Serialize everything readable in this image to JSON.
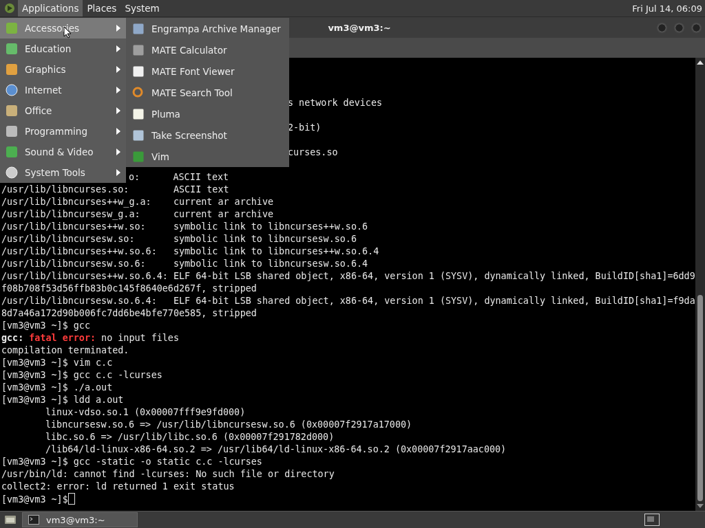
{
  "top_panel": {
    "menus": [
      {
        "label": "Applications",
        "selected": true
      },
      {
        "label": "Places",
        "selected": false
      },
      {
        "label": "System",
        "selected": false
      }
    ],
    "clock": "Fri Jul 14, 06:09"
  },
  "applications_menu": {
    "items": [
      {
        "label": "Accessories",
        "selected": true
      },
      {
        "label": "Education",
        "selected": false
      },
      {
        "label": "Graphics",
        "selected": false
      },
      {
        "label": "Internet",
        "selected": false
      },
      {
        "label": "Office",
        "selected": false
      },
      {
        "label": "Programming",
        "selected": false
      },
      {
        "label": "Sound & Video",
        "selected": false
      },
      {
        "label": "System Tools",
        "selected": false
      }
    ],
    "submenu": [
      {
        "label": "Engrampa Archive Manager"
      },
      {
        "label": "MATE Calculator"
      },
      {
        "label": "MATE Font Viewer"
      },
      {
        "label": "MATE Search Tool"
      },
      {
        "label": "Pluma"
      },
      {
        "label": "Take Screenshot"
      },
      {
        "label": "Vim"
      }
    ]
  },
  "window": {
    "title": "vm3@vm3:~"
  },
  "terminal": {
    "lines": [
      {
        "kind": "blank"
      },
      {
        "kind": "blank"
      },
      {
        "kind": "blank"
      },
      {
        "kind": "behind-submenu",
        "text": "s network devices"
      },
      {
        "kind": "blank"
      },
      {
        "kind": "behind-submenu",
        "text": "2-bit)"
      },
      {
        "kind": "blank"
      },
      {
        "kind": "behind-submenu",
        "text": "curses.so"
      },
      {
        "kind": "blank"
      },
      {
        "kind": "behind-menu",
        "text": "o:      ASCII text"
      },
      {
        "kind": "plain",
        "text": "/usr/lib/libncurses.so:        ASCII text"
      },
      {
        "kind": "plain",
        "text": "/usr/lib/libncurses++w_g.a:    current ar archive"
      },
      {
        "kind": "plain",
        "text": "/usr/lib/libncursesw_g.a:      current ar archive"
      },
      {
        "kind": "plain",
        "text": "/usr/lib/libncurses++w.so:     symbolic link to libncurses++w.so.6"
      },
      {
        "kind": "plain",
        "text": "/usr/lib/libncursesw.so:       symbolic link to libncursesw.so.6"
      },
      {
        "kind": "plain",
        "text": "/usr/lib/libncurses++w.so.6:   symbolic link to libncurses++w.so.6.4"
      },
      {
        "kind": "plain",
        "text": "/usr/lib/libncursesw.so.6:     symbolic link to libncursesw.so.6.4"
      },
      {
        "kind": "plain",
        "text": "/usr/lib/libncurses++w.so.6.4: ELF 64-bit LSB shared object, x86-64, version 1 (SYSV), dynamically linked, BuildID[sha1]=6dd9"
      },
      {
        "kind": "plain",
        "text": "f08b708f53d56ffb83b0c145f8640e6d267f, stripped"
      },
      {
        "kind": "plain",
        "text": "/usr/lib/libncursesw.so.6.4:   ELF 64-bit LSB shared object, x86-64, version 1 (SYSV), dynamically linked, BuildID[sha1]=f9da"
      },
      {
        "kind": "plain",
        "text": "8d7a46a172d90b006fc7dd6be4bfe770e585, stripped"
      },
      {
        "kind": "plain",
        "text": "[vm3@vm3 ~]$ gcc"
      },
      {
        "kind": "error",
        "parts": [
          {
            "text": "gcc:",
            "kind": "program"
          },
          {
            "text": " fatal error:",
            "kind": "severity"
          },
          {
            "text": " no input files",
            "kind": "message"
          }
        ]
      },
      {
        "kind": "plain",
        "text": "compilation terminated."
      },
      {
        "kind": "plain",
        "text": "[vm3@vm3 ~]$ vim c.c"
      },
      {
        "kind": "plain",
        "text": "[vm3@vm3 ~]$ gcc c.c -lcurses"
      },
      {
        "kind": "plain",
        "text": "[vm3@vm3 ~]$ ./a.out"
      },
      {
        "kind": "plain",
        "text": "[vm3@vm3 ~]$ ldd a.out"
      },
      {
        "kind": "indented",
        "text": "linux-vdso.so.1 (0x00007fff9e9fd000)"
      },
      {
        "kind": "indented",
        "text": "libncursesw.so.6 => /usr/lib/libncursesw.so.6 (0x00007f2917a17000)"
      },
      {
        "kind": "indented",
        "text": "libc.so.6 => /usr/lib/libc.so.6 (0x00007f291782d000)"
      },
      {
        "kind": "indented",
        "text": "/lib64/ld-linux-x86-64.so.2 => /usr/lib64/ld-linux-x86-64.so.2 (0x00007f2917aac000)"
      },
      {
        "kind": "plain",
        "text": "[vm3@vm3 ~]$ gcc -static -o static c.c -lcurses"
      },
      {
        "kind": "plain",
        "text": "/usr/bin/ld: cannot find -lcurses: No such file or directory"
      },
      {
        "kind": "plain",
        "text": "collect2: error: ld returned 1 exit status"
      },
      {
        "kind": "prompt",
        "text": "[vm3@vm3 ~]$"
      }
    ]
  },
  "bottom_panel": {
    "tasks": [
      {
        "label": "vm3@vm3:~",
        "selected": false
      }
    ]
  }
}
